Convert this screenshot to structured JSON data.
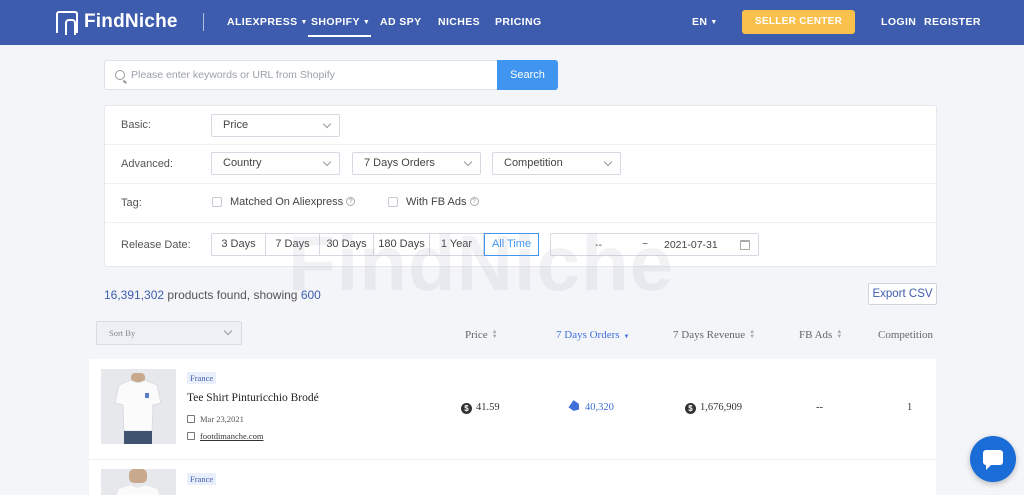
{
  "header": {
    "brand": "FindNiche",
    "nav": [
      {
        "label": "ALIEXPRESS",
        "has_caret": true
      },
      {
        "label": "SHOPIFY",
        "has_caret": true,
        "active": true
      },
      {
        "label": "AD SPY"
      },
      {
        "label": "NICHES"
      },
      {
        "label": "PRICING"
      }
    ],
    "language": "EN",
    "seller_center": "SELLER CENTER",
    "login": "LOGIN",
    "register": "REGISTER"
  },
  "search": {
    "placeholder": "Please enter keywords or URL from Shopify",
    "button": "Search"
  },
  "filters": {
    "basic_label": "Basic:",
    "price_dropdown": "Price",
    "advanced_label": "Advanced:",
    "country_dropdown": "Country",
    "orders_dropdown": "7 Days Orders",
    "competition_dropdown": "Competition",
    "tag_label": "Tag:",
    "matched_aliexpress": "Matched On Aliexpress",
    "with_fb_ads": "With FB Ads",
    "release_label": "Release Date:",
    "release_options": [
      "3 Days",
      "7 Days",
      "30 Days",
      "180 Days",
      "1 Year",
      "All Time"
    ],
    "release_active": "All Time",
    "date_from": "--",
    "date_sep": "~",
    "date_to": "2021-07-31"
  },
  "watermark": "FindNiche",
  "results": {
    "total": "16,391,302",
    "middle": " products found, showing ",
    "showing": "600",
    "export": "Export CSV"
  },
  "table": {
    "sort_by": "Sort By",
    "columns": {
      "price": "Price",
      "orders": "7 Days Orders",
      "revenue": "7 Days Revenue",
      "fb_ads": "FB Ads",
      "competition": "Competition"
    },
    "rows": [
      {
        "country": "France",
        "title": "Tee Shirt Pinturicchio Brodé",
        "date": "Mar 23,2021",
        "store": "footdimanche.com",
        "price": "41.59",
        "orders": "40,320",
        "revenue": "1,676,909",
        "fb_ads": "--",
        "competition": "1"
      },
      {
        "country": "France"
      }
    ]
  },
  "colors": {
    "header_bg": "#3d5cad",
    "accent_blue": "#3f95f0",
    "seller_yellow": "#f9c04b"
  }
}
